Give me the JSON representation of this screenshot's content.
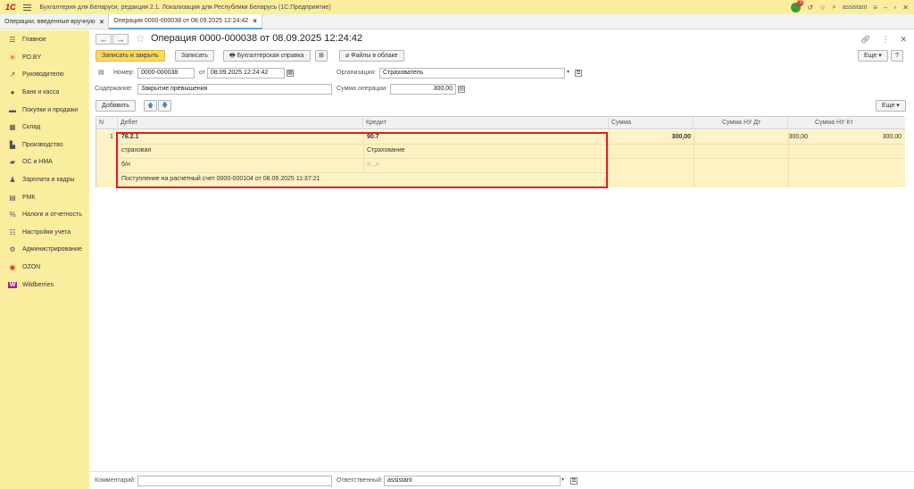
{
  "app": {
    "title": "Бухгалтерия для Беларуси, редакция 2.1. Локализация для Республики Беларусь   (1С:Предприятие)",
    "logo": "1С",
    "user": "assistant",
    "notification_count": "1"
  },
  "tabs": [
    {
      "label": "Операции, введенные вручную"
    },
    {
      "label": "Операция 0000-000038 от 08.09.2025 12:24:42"
    }
  ],
  "sidebar": {
    "items": [
      {
        "label": "Главное",
        "icon": "list-icon"
      },
      {
        "label": "РО.BY",
        "icon": "asterisk-icon"
      },
      {
        "label": "Руководителю",
        "icon": "trend-icon"
      },
      {
        "label": "Банк и касса",
        "icon": "coin-icon"
      },
      {
        "label": "Покупки и продажи",
        "icon": "cart-icon"
      },
      {
        "label": "Склад",
        "icon": "warehouse-icon"
      },
      {
        "label": "Производство",
        "icon": "factory-icon"
      },
      {
        "label": "ОС и НМА",
        "icon": "truck-icon"
      },
      {
        "label": "Зарплата и кадры",
        "icon": "person-icon"
      },
      {
        "label": "РМК",
        "icon": "register-icon"
      },
      {
        "label": "Налоги и отчетность",
        "icon": "percent-icon"
      },
      {
        "label": "Настройки учета",
        "icon": "settings-list-icon"
      },
      {
        "label": "Администрирование",
        "icon": "gear-icon"
      },
      {
        "label": "OZON",
        "icon": "ozon-icon"
      },
      {
        "label": "Wildberries",
        "icon": "wildberries-icon"
      }
    ]
  },
  "form": {
    "title": "Операция 0000-000038 от 08.09.2025 12:24:42",
    "buttons": {
      "save_close": "Записать и закрыть",
      "save": "Записать",
      "accounting_ref": "Бухгалтерская справка",
      "files_cloud": "Файлы в облаке",
      "more": "Еще",
      "help": "?",
      "add": "Добавить",
      "more_table": "Еще"
    },
    "fields": {
      "number_label": "Номер:",
      "number_value": "0000-000038",
      "date_label": "от",
      "date_value": "08.09.2025 12:24:42",
      "org_label": "Организация:",
      "org_value": "Страхователь",
      "content_label": "Содержание:",
      "content_value": "Закрытие превышения",
      "sum_label": "Сумма операции:",
      "sum_value": "300,00",
      "comment_label": "Комментарий:",
      "comment_value": "",
      "responsible_label": "Ответственный:",
      "responsible_value": "assistant"
    },
    "table": {
      "columns": [
        "N",
        "Дебет",
        "Кредит",
        "Сумма",
        "Сумма НУ Дт",
        "Сумма НУ Кт"
      ],
      "row": {
        "n": "1",
        "debit_account": "76.2.1",
        "debit_sub1": "страховая",
        "debit_sub2": "б/н",
        "debit_sub3": "Поступление на расчетный счет 0000-000104 от 08.09.2025 11:37:21",
        "credit_account": "90.7",
        "credit_sub1": "Страхование",
        "credit_sub2": "<...>",
        "sum": "300,00",
        "sum_nu_dt": "300,00",
        "sum_nu_kt": "300,00"
      }
    }
  },
  "colors": {
    "sidebar_bg": "#fbed9e",
    "primary_button": "#fbd95f",
    "row_highlight": "#fcf2c4",
    "red_frame": "#d9202a"
  }
}
